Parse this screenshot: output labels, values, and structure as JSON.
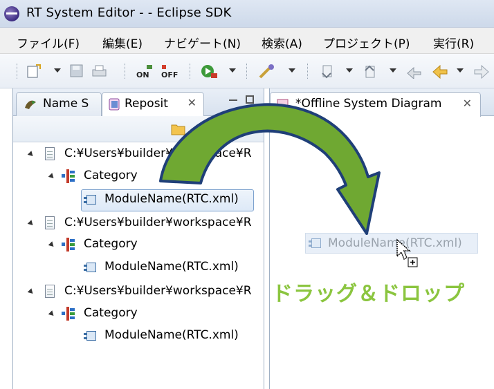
{
  "window": {
    "title": "RT System Editor -  - Eclipse SDK"
  },
  "menu": [
    "ファイル(F)",
    "編集(E)",
    "ナビゲート(N)",
    "検索(A)",
    "プロジェクト(P)",
    "実行(R)"
  ],
  "toolbar": {
    "on_label": "ON",
    "off_label": "OFF"
  },
  "left_tabs": [
    {
      "label": "Name S",
      "icon": "name-service-icon"
    },
    {
      "label": "Reposit",
      "icon": "repository-icon"
    }
  ],
  "tree": {
    "groups": [
      {
        "path": "C:¥Users¥builder¥workspace¥R",
        "category": "Category",
        "module": "ModuleName(RTC.xml)",
        "selected": true
      },
      {
        "path": "C:¥Users¥builder¥workspace¥R",
        "category": "Category",
        "module": "ModuleName(RTC.xml)",
        "selected": false
      },
      {
        "path": "C:¥Users¥builder¥workspace¥R",
        "category": "Category",
        "module": "ModuleName(RTC.xml)",
        "selected": false
      }
    ]
  },
  "editor": {
    "tab_label": "*Offline System Diagram"
  },
  "drag_ghost": {
    "label": "ModuleName(RTC.xml)"
  },
  "annotation": {
    "text": "ドラッグ＆ドロップ",
    "color": "#8bc53f"
  },
  "colors": {
    "arrow_fill": "#6fa832",
    "arrow_outline": "#1f3f78"
  }
}
